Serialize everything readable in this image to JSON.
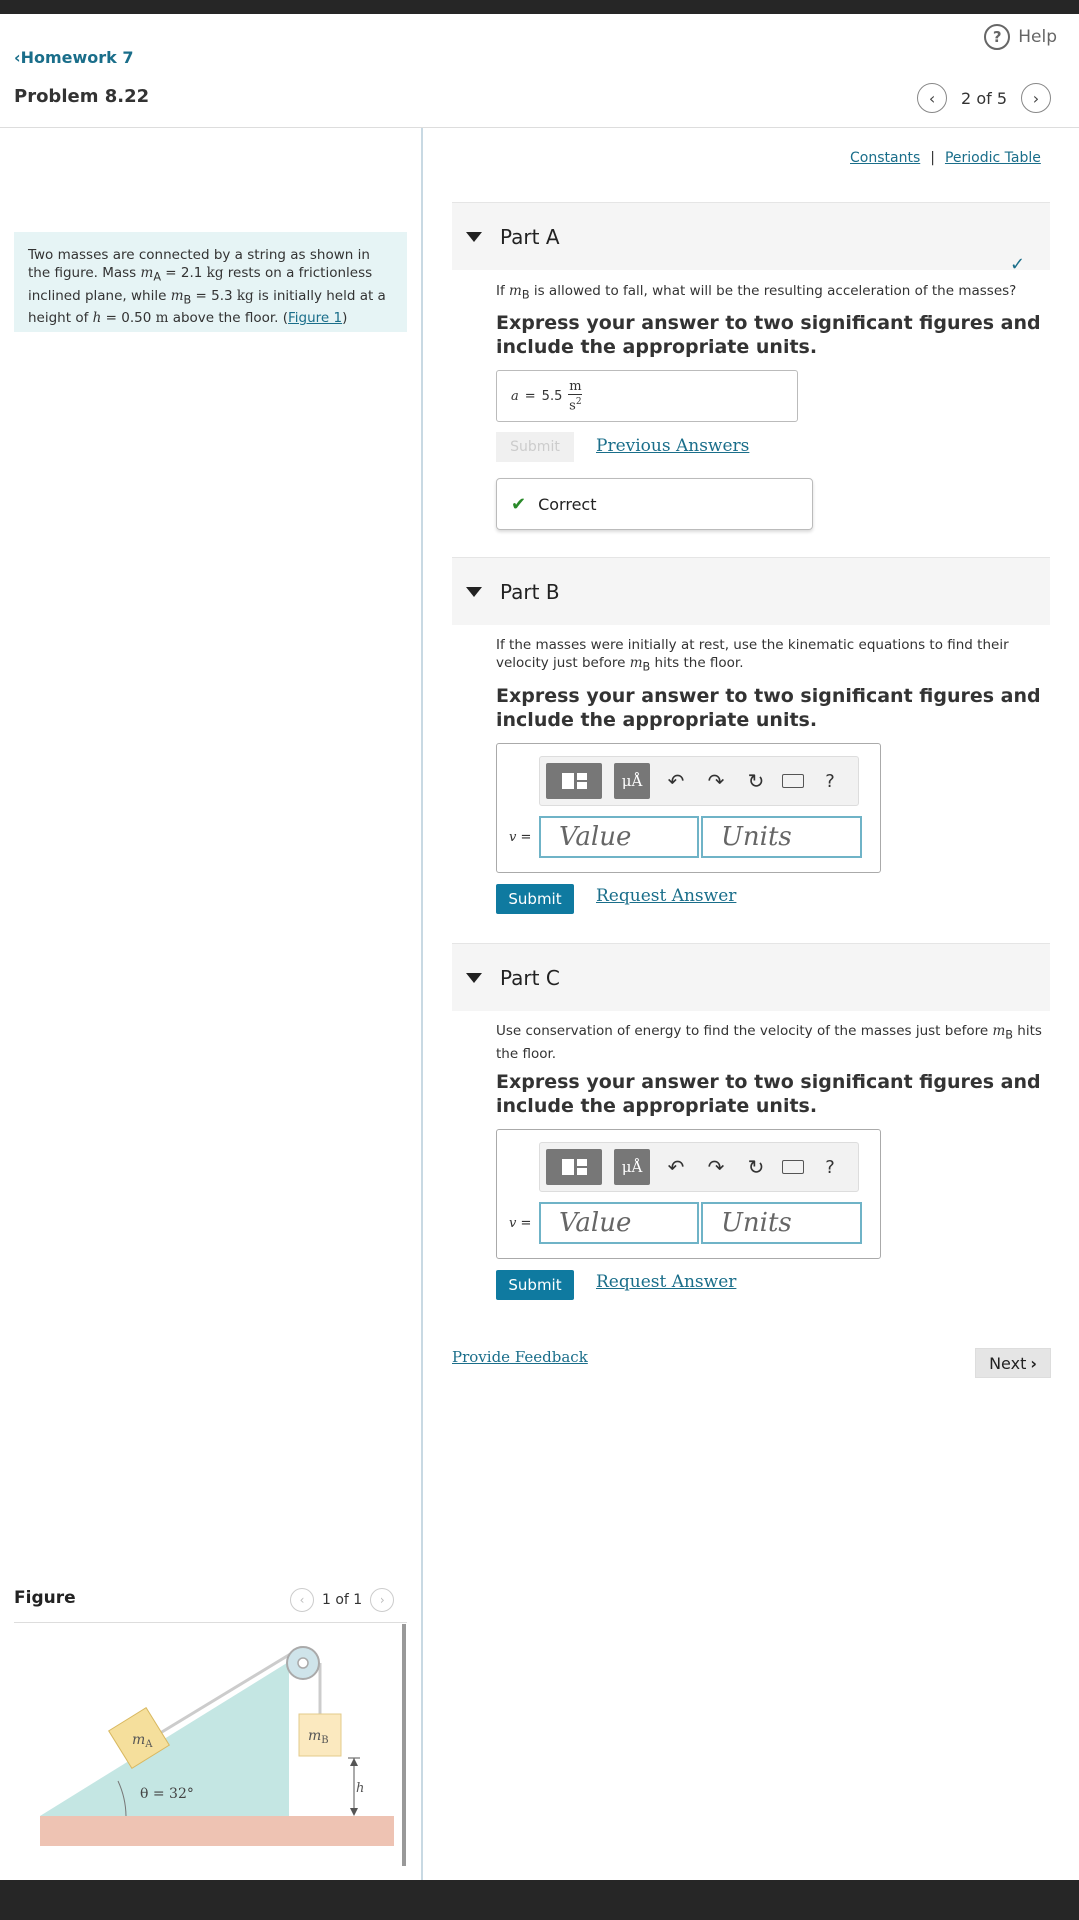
{
  "header": {
    "help_label": "Help",
    "back_label": "Homework 7",
    "problem_title": "Problem 8.22",
    "pager": "2 of 5"
  },
  "intro": {
    "t1": "Two masses are connected by a string as shown in the figure. Mass ",
    "mA": "m",
    "mA_sub": "A",
    "t2": " = 2.1 ",
    "kg1": "kg",
    "t3": " rests on a frictionless inclined plane, while ",
    "mB": "m",
    "mB_sub": "B",
    "t4": " = 5.3 ",
    "kg2": "kg",
    "t5": " is initially held at a height of ",
    "h": "h",
    "t6": " = 0.50 ",
    "m": "m",
    "t7": " above the floor. (",
    "fig_link": "Figure 1",
    "t8": ")"
  },
  "figure": {
    "label": "Figure",
    "pager": "1 of 1",
    "mass_a": "m",
    "mass_a_sub": "A",
    "mass_b": "m",
    "mass_b_sub": "B",
    "height": "h",
    "angle": "θ = 32°"
  },
  "links": {
    "constants": "Constants",
    "sep": "|",
    "periodic": "Periodic Table"
  },
  "partA": {
    "title": "Part A",
    "q1": "If ",
    "qm": "m",
    "qsub": "B",
    "q2": " is allowed to fall, what will be the resulting acceleration of the masses?",
    "instructions": "Express your answer to two significant figures and include the appropriate units.",
    "var": "a",
    "eq": "=",
    "value": "5.5",
    "unit_num": "m",
    "unit_den": "s",
    "unit_exp": "2",
    "submit": "Submit",
    "prev_answers": "Previous Answers",
    "feedback": "Correct"
  },
  "partB": {
    "title": "Part B",
    "q1": "If the masses were initially at rest, use the kinematic equations to find their velocity just before ",
    "qm": "m",
    "qsub": "B",
    "q2": " hits the floor.",
    "instructions": "Express your answer to two significant figures and include the appropriate units.",
    "var": "v",
    "eq": "=",
    "value_placeholder": "Value",
    "units_placeholder": "Units",
    "submit": "Submit",
    "request": "Request Answer"
  },
  "partC": {
    "title": "Part C",
    "q1": "Use conservation of energy to find the velocity of the masses just before ",
    "qm": "m",
    "qsub": "B",
    "q2": " hits the floor.",
    "instructions": "Express your answer to two significant figures and include the appropriate units.",
    "var": "v",
    "eq": "=",
    "value_placeholder": "Value",
    "units_placeholder": "Units",
    "submit": "Submit",
    "request": "Request Answer"
  },
  "toolbar": {
    "mu": "μÅ",
    "help": "?"
  },
  "footer": {
    "feedback": "Provide Feedback",
    "next": "Next"
  }
}
